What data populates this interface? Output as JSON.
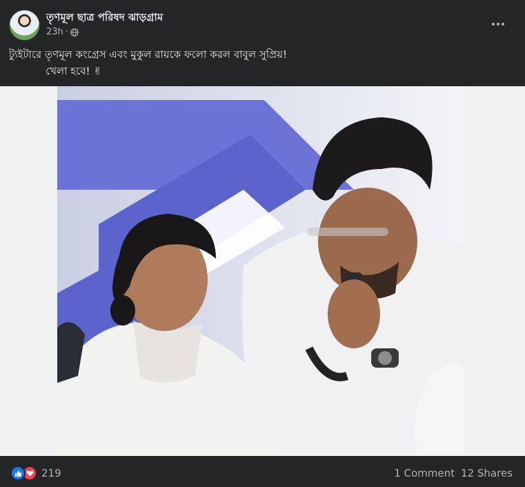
{
  "post": {
    "page_name": "তৃণমূল ছাত্র পরিষদ ঝাড়গ্রাম",
    "timestamp": "23h",
    "privacy_icon": "globe-icon",
    "text_line1": "ট্যুইটারে তৃণমূল কংগ্রেস এবং মুকুল রায়কে ফলো করল বাবুল সুপ্রিয়!",
    "text_line2": "খেলা হবে! ✌",
    "reactions_count": "219",
    "comments": "1 Comment",
    "shares": "12 Shares"
  },
  "colors": {
    "background": "#242526",
    "text_primary": "#e4e6eb",
    "text_secondary": "#b0b3b8",
    "like_blue": "#1877f2",
    "love_red": "#f33e58"
  }
}
